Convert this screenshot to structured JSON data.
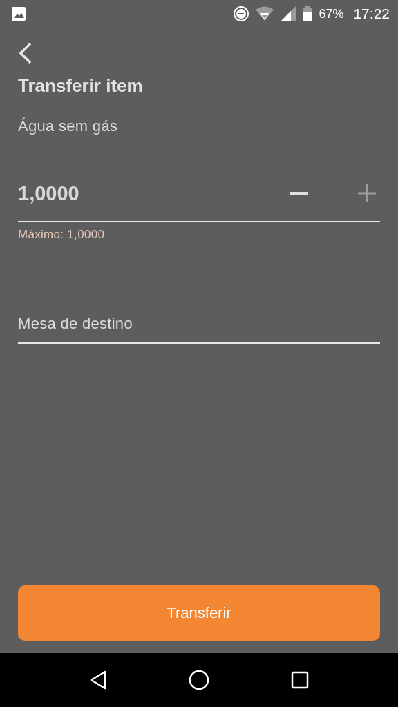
{
  "status_bar": {
    "battery": "67%",
    "time": "17:22"
  },
  "title": "Transferir item",
  "item_name": "Água sem gás",
  "quantity": {
    "value": "1,0000",
    "helper": "Máximo: 1,0000",
    "decrement_disabled": false,
    "increment_disabled": true
  },
  "destination": {
    "placeholder": "Mesa de destino"
  },
  "submit": {
    "label": "Transferir"
  }
}
